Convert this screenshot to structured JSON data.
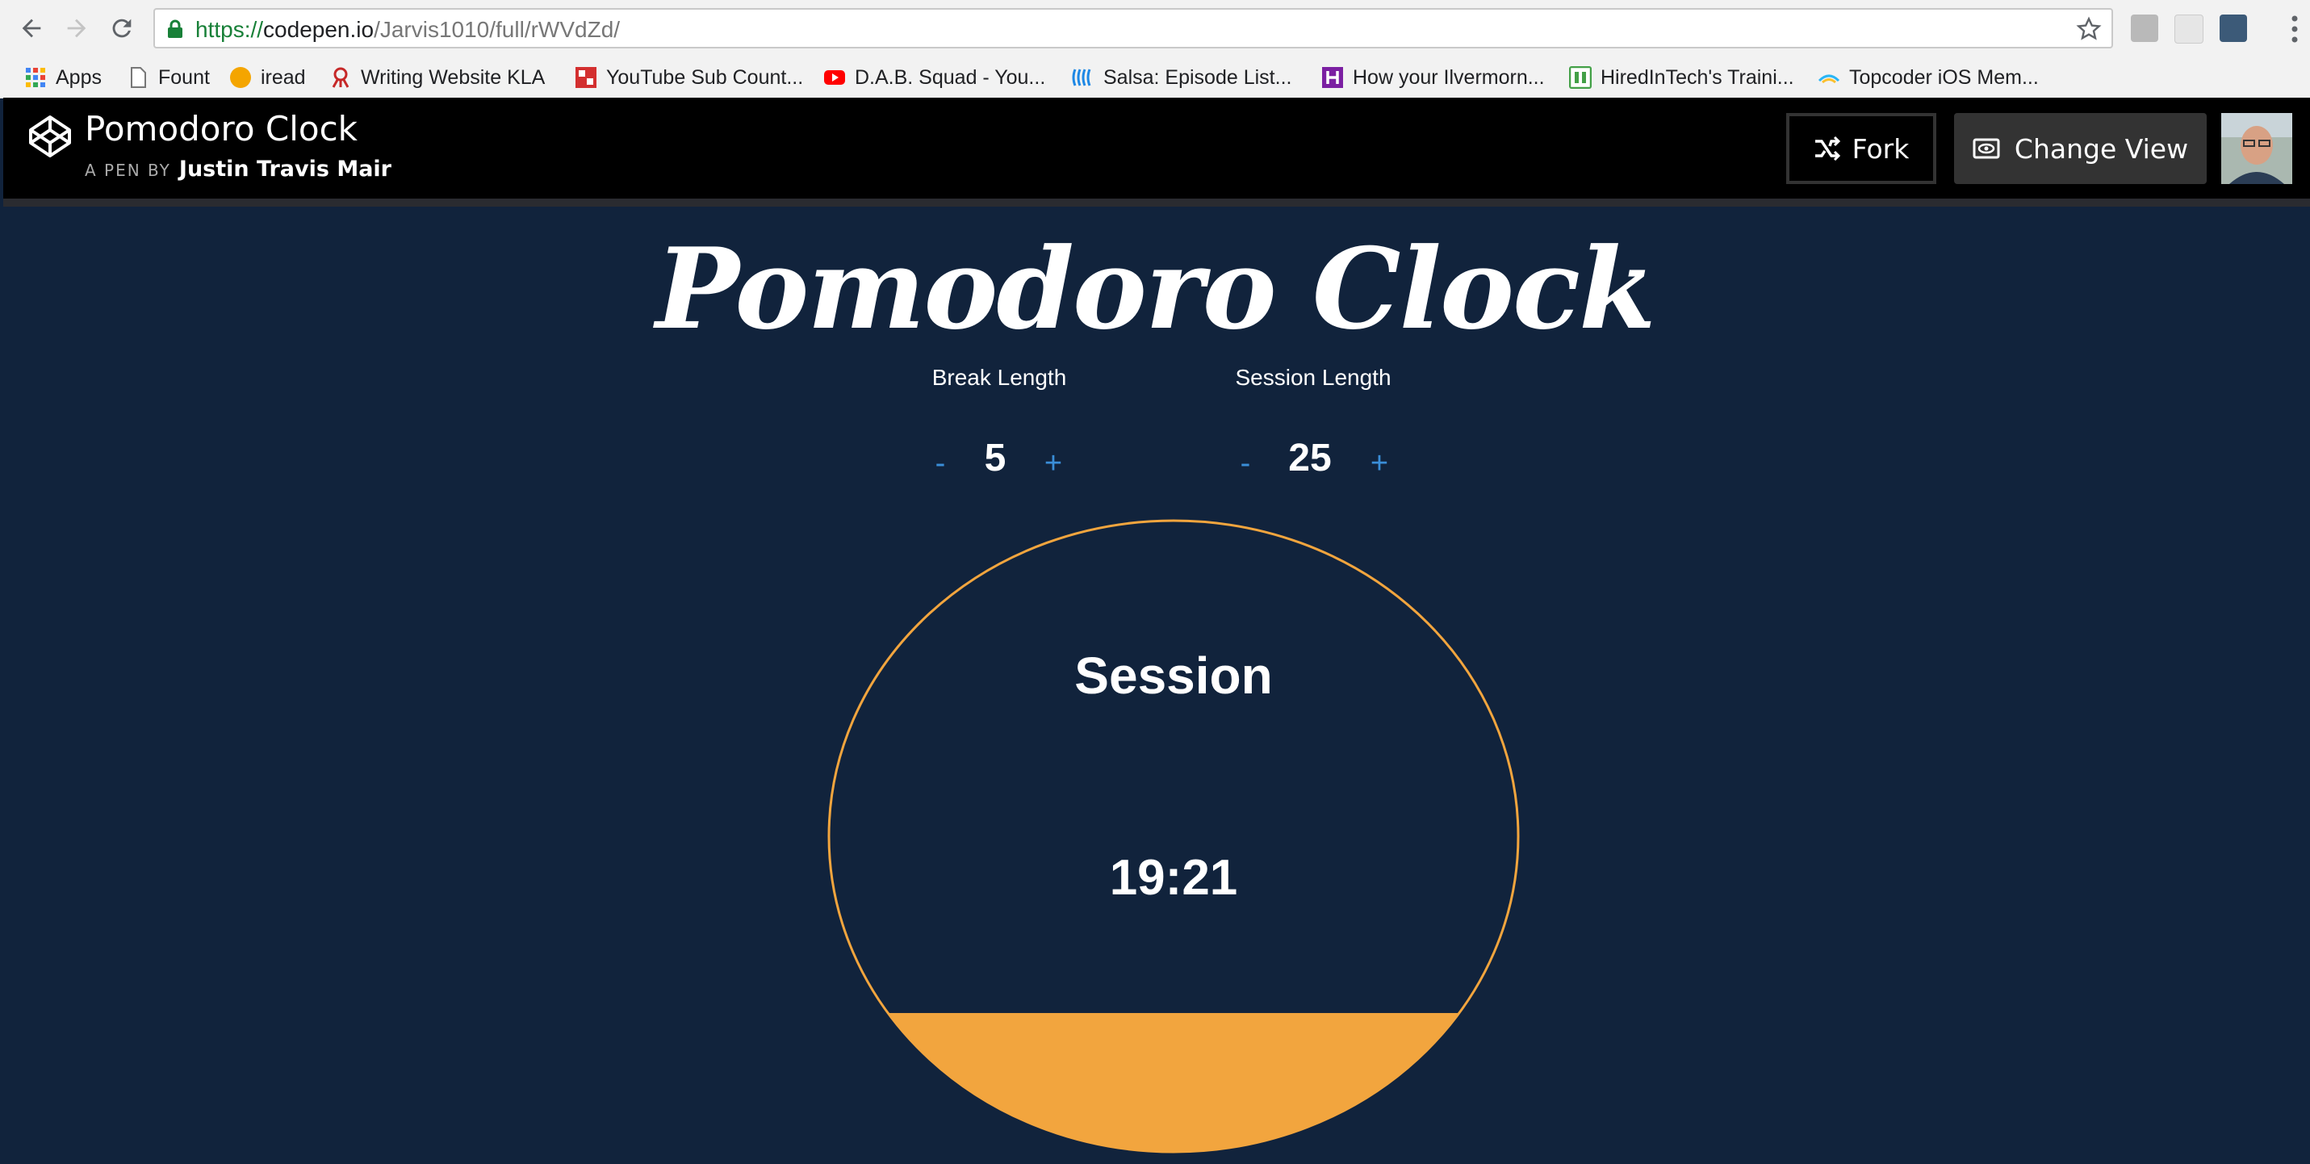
{
  "browser": {
    "url_scheme": "https://",
    "url_host": "codepen.io",
    "url_path": "/Jarvis1010/full/rWVdZd/"
  },
  "bookmarks": [
    {
      "label": "Apps",
      "icon": "apps-grid-icon",
      "color": "#4285f4"
    },
    {
      "label": "Fount",
      "icon": "page-icon",
      "color": "#888888"
    },
    {
      "label": "iread",
      "icon": "circle-icon",
      "color": "#f4a500"
    },
    {
      "label": "Writing Website KLA",
      "icon": "octopus-icon",
      "color": "#c62828"
    },
    {
      "label": "YouTube Sub Count...",
      "icon": "ytsc-icon",
      "color": "#d32f2f"
    },
    {
      "label": "D.A.B. Squad - You...",
      "icon": "youtube-icon",
      "color": "#ff0000"
    },
    {
      "label": "Salsa: Episode List...",
      "icon": "salsa-icon",
      "color": "#1e88e5"
    },
    {
      "label": "How your Ilvermorn...",
      "icon": "h-icon",
      "color": "#7b1fa2"
    },
    {
      "label": "HiredInTech's Traini...",
      "icon": "hiredintech-icon",
      "color": "#43a047"
    },
    {
      "label": "Topcoder iOS Mem...",
      "icon": "topcoder-icon",
      "color": "#29b6f6"
    }
  ],
  "codepen": {
    "title": "Pomodoro Clock",
    "a_pen_by": "A PEN BY",
    "author": "Justin Travis Mair",
    "fork_label": "Fork",
    "change_view_label": "Change View"
  },
  "app": {
    "title": "Pomodoro Clock",
    "break": {
      "label": "Break Length",
      "value": "5",
      "minus": "-",
      "plus": "+"
    },
    "session": {
      "label": "Session Length",
      "value": "25",
      "minus": "-",
      "plus": "+"
    },
    "clock": {
      "label": "Session",
      "time": "19:21",
      "fill_fraction": 0.22
    },
    "colors": {
      "background": "#11233c",
      "accent": "#f2a53e",
      "button": "#3a8ed8"
    }
  }
}
